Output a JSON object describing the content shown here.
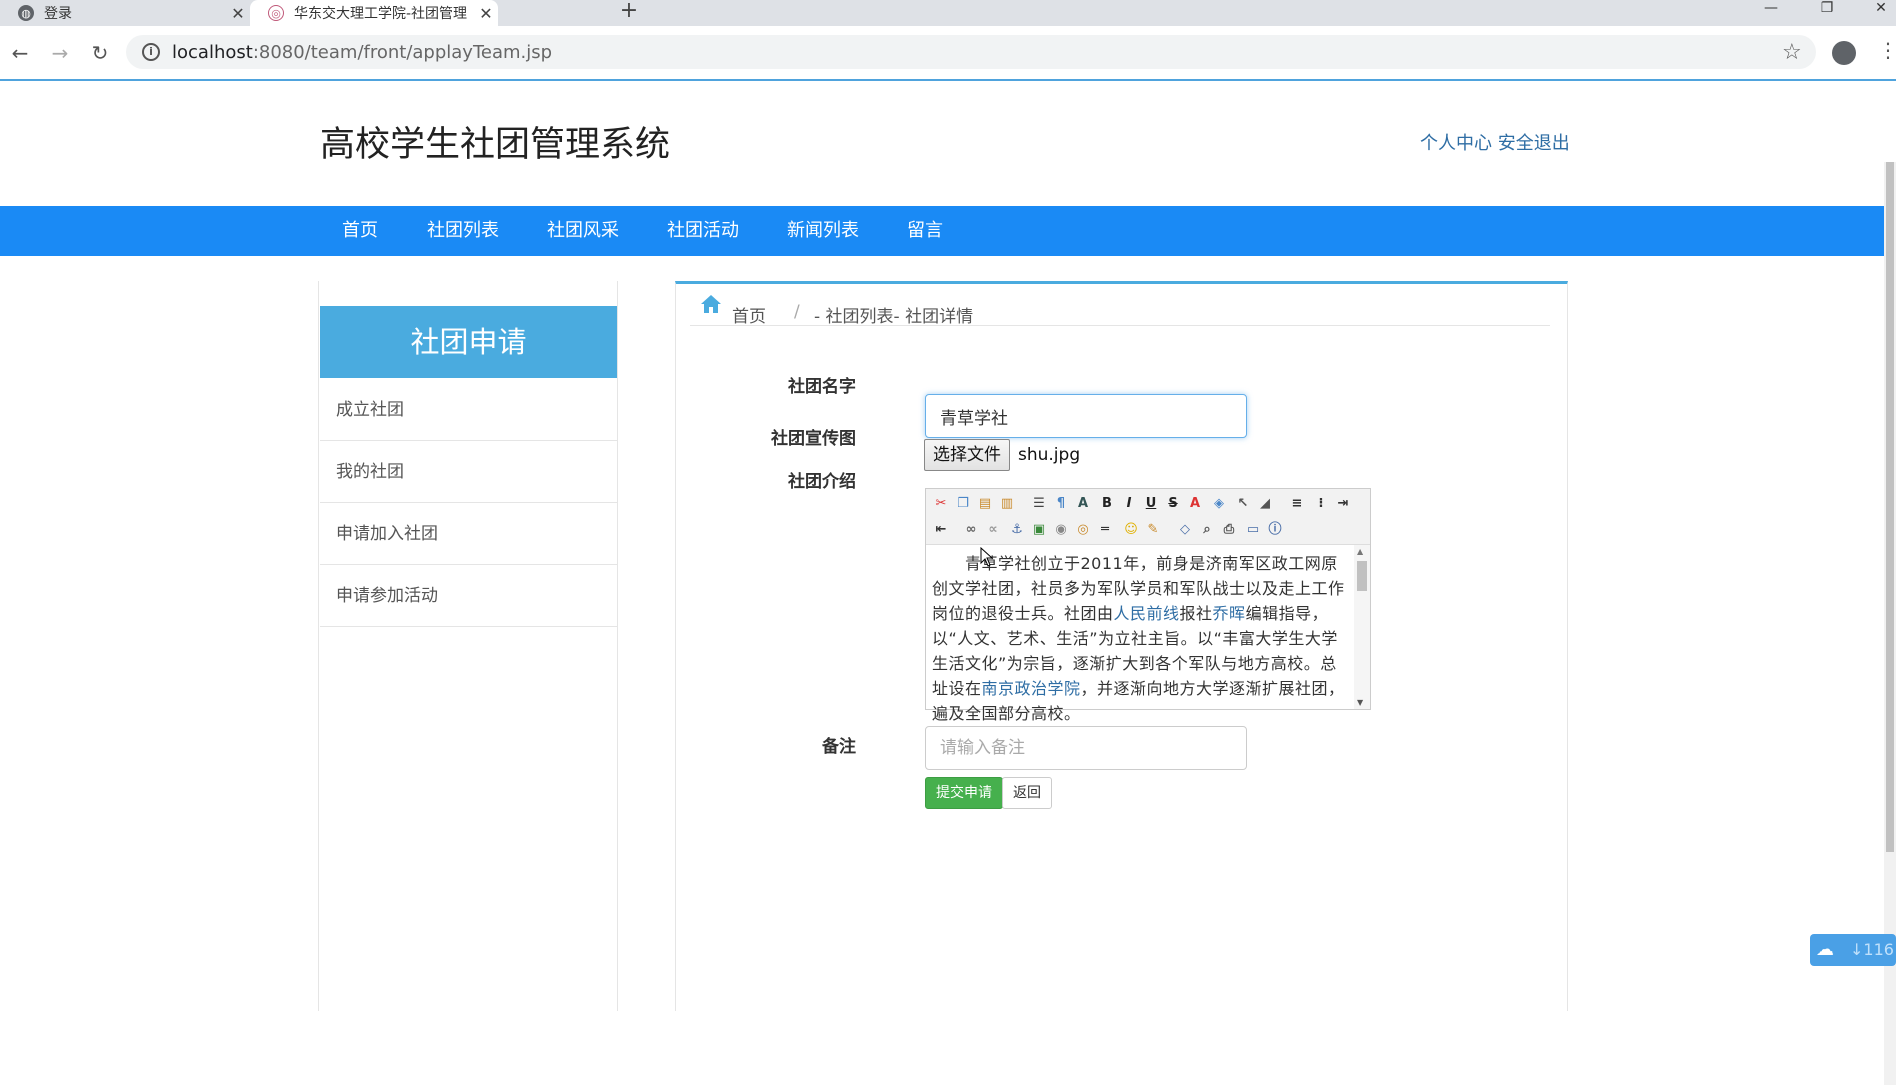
{
  "browser": {
    "tabs": [
      {
        "title": "登录",
        "active": false
      },
      {
        "title": "华东交大理工学院-社团管理",
        "active": true
      }
    ],
    "url_host": "localhost",
    "url_rest": ":8080/team/front/applayTeam.jsp"
  },
  "header": {
    "site_title": "高校学生社团管理系统",
    "personal_center": "个人中心",
    "logout": "安全退出"
  },
  "nav": [
    "首页",
    "社团列表",
    "社团风采",
    "社团活动",
    "新闻列表",
    "留言"
  ],
  "sidebar": {
    "title": "社团申请",
    "items": [
      "成立社团",
      "我的社团",
      "申请加入社团",
      "申请参加活动"
    ]
  },
  "breadcrumb": {
    "home": "首页",
    "separator": "/",
    "path": "- 社团列表- 社团详情"
  },
  "form": {
    "name_label": "社团名字",
    "name_value": "青草学社",
    "image_label": "社团宣传图",
    "file_button": "选择文件",
    "file_name": "shu.jpg",
    "intro_label": "社团介绍",
    "intro_segments": [
      {
        "text": "　　青草学社创立于2011年，前身是济南军区政工网原创文学社团，社员多为军队学员和军队战士以及走上工作岗位的退役士兵。社团由",
        "link": false
      },
      {
        "text": "人民前线",
        "link": true
      },
      {
        "text": "报社",
        "link": false
      },
      {
        "text": "乔晖",
        "link": true
      },
      {
        "text": "编辑指导，以“人文、艺术、生活”为立社主旨。以“丰富大学生大学生活文化”为宗旨，逐渐扩大到各个军队与地方高校。总址设在",
        "link": false
      },
      {
        "text": "南京政治学院",
        "link": true
      },
      {
        "text": "，并逐渐向地方大学逐渐扩展社团，遍及全国部分高校。",
        "link": false
      }
    ],
    "remark_label": "备注",
    "remark_placeholder": "请输入备注",
    "submit": "提交申请",
    "back": "返回"
  },
  "widget": {
    "count": "116"
  },
  "colors": {
    "nav": "#1a8af5",
    "sidebar_head": "#4aabdf",
    "submit": "#46b04d",
    "link": "#2e6da4"
  }
}
